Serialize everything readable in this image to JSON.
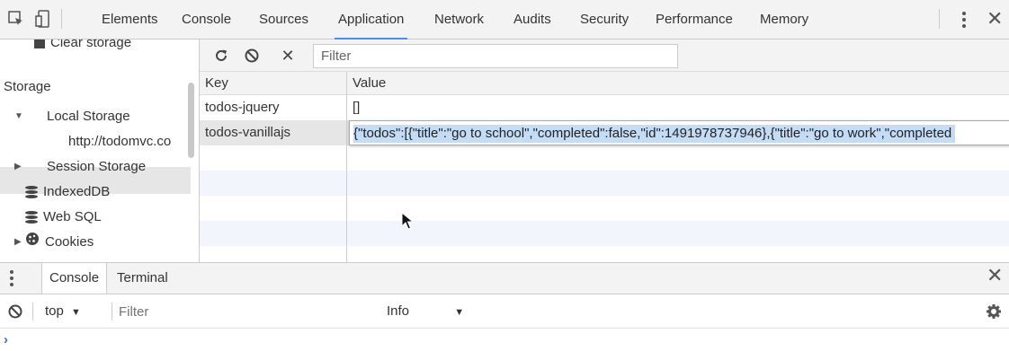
{
  "toolbar": {
    "tabs": [
      "Elements",
      "Console",
      "Sources",
      "Application",
      "Network",
      "Audits",
      "Security",
      "Performance",
      "Memory"
    ],
    "active_tab": "Application",
    "icons": {
      "inspect": "inspect-element-icon",
      "device": "device-toolbar-icon",
      "menu": "kebab-menu-icon",
      "close": "close-icon"
    }
  },
  "sidebar": {
    "clear_storage": "Clear storage",
    "section_title": "Storage",
    "items": [
      {
        "label": "Local Storage",
        "icon": "grid-icon",
        "expanded": true
      },
      {
        "label": "http://todomvc.co",
        "icon": "grid-icon",
        "selected": true
      },
      {
        "label": "Session Storage",
        "icon": "grid-icon",
        "expanded": false
      },
      {
        "label": "IndexedDB",
        "icon": "database-icon"
      },
      {
        "label": "Web SQL",
        "icon": "database-icon"
      },
      {
        "label": "Cookies",
        "icon": "cookie-icon",
        "expanded": false
      }
    ]
  },
  "main": {
    "filter_placeholder": "Filter",
    "columns": {
      "key": "Key",
      "value": "Value"
    },
    "rows": [
      {
        "key": "todos-jquery",
        "value": "[]"
      },
      {
        "key": "todos-vanillajs",
        "value": "{\"todos\":[{\"title\":\"go to school\",\"completed\":false,\"id\":1491978737946},{\"title\":\"go to work\",\"completed"
      }
    ]
  },
  "drawer": {
    "tabs": [
      "Console",
      "Terminal"
    ],
    "active_tab": "Console",
    "context": "top",
    "filter_placeholder": "Filter",
    "level": "Info",
    "prompt": "›"
  },
  "colors": {
    "accent": "#4c8bf5",
    "selection": "#c5dcf7",
    "toolbar_bg": "#f3f3f3",
    "alt_row": "#f2f6fc"
  }
}
